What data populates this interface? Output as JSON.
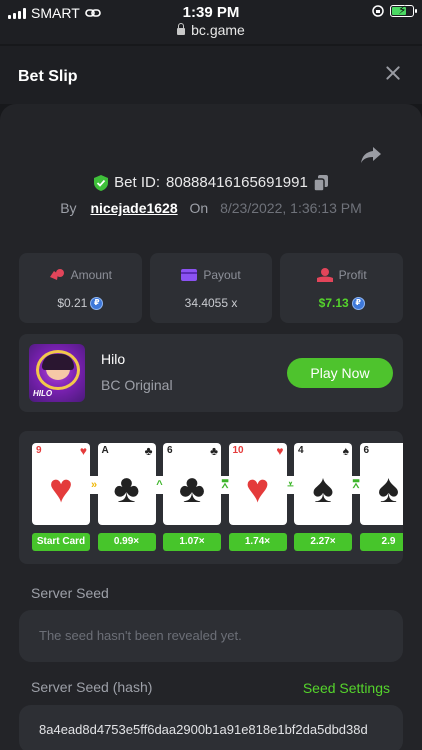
{
  "status_bar": {
    "carrier": "SMART",
    "time": "1:39 PM"
  },
  "browser": {
    "url": "bc.game"
  },
  "header": {
    "title": "Bet Slip"
  },
  "bet": {
    "id_label": "Bet ID:",
    "id": "80888416165691991",
    "by_label": "By",
    "user": "nicejade1628",
    "on_label": "On",
    "date": "8/23/2022, 1:36:13 PM"
  },
  "stats": {
    "amount": {
      "label": "Amount",
      "value": "$0.21"
    },
    "payout": {
      "label": "Payout",
      "value": "34.4055 x"
    },
    "profit": {
      "label": "Profit",
      "value": "$7.13"
    }
  },
  "game": {
    "name": "Hilo",
    "subtitle": "BC Original",
    "thumb_text": "HILO",
    "play_label": "Play Now"
  },
  "cards": [
    {
      "rank": "9",
      "suit": "♥",
      "color": "red",
      "mult": "Start Card",
      "arrow": "»",
      "arrow_color": "yellow"
    },
    {
      "rank": "A",
      "suit": "♣",
      "color": "black",
      "mult": "0.99×",
      "arrow": "^",
      "arrow_color": "green"
    },
    {
      "rank": "6",
      "suit": "♣",
      "color": "black",
      "mult": "1.07×",
      "arrow": "⩞",
      "arrow_color": "green"
    },
    {
      "rank": "10",
      "suit": "♥",
      "color": "red",
      "mult": "1.74×",
      "arrow": "⩡",
      "arrow_color": "green"
    },
    {
      "rank": "4",
      "suit": "♠",
      "color": "black",
      "mult": "2.27×",
      "arrow": "⩞",
      "arrow_color": "green"
    },
    {
      "rank": "6",
      "suit": "♠",
      "color": "black",
      "mult": "2.9",
      "arrow": "",
      "arrow_color": "green"
    }
  ],
  "server_seed": {
    "label": "Server Seed",
    "value": "The seed hasn't been revealed yet."
  },
  "server_seed_hash": {
    "label": "Server Seed (hash)",
    "link": "Seed Settings",
    "value": "8a4ead8d4753e5ff6daa2900b1a91e818e1bf2da5dbd38d"
  },
  "colors": {
    "accent": "#4ec32d",
    "panel": "#2d2f34",
    "background": "#17181b"
  }
}
